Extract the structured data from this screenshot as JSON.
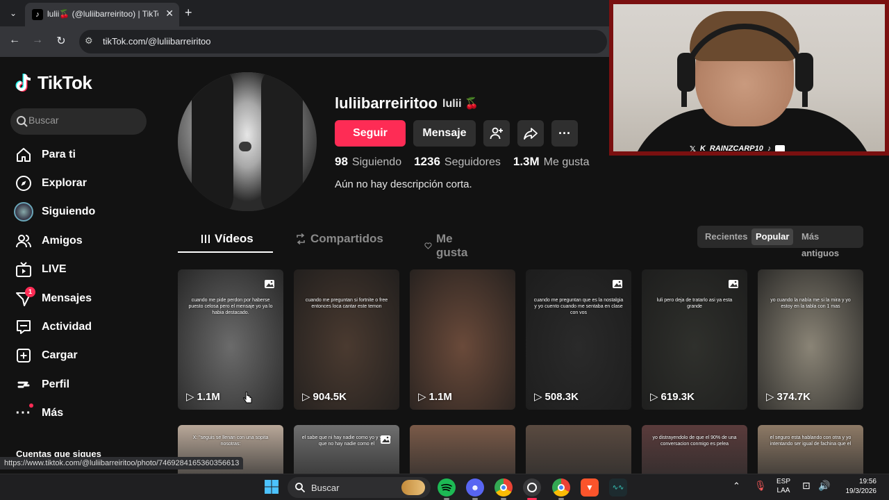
{
  "browser": {
    "tab_title": "lulii🍒 (@luliibarreiritoo) | TikTo",
    "address": "tikTok.com/@luliibarreiritoo",
    "status_link": "https://www.tiktok.com/@luliibarreiritoo/photo/7469284165360356613"
  },
  "sidebar": {
    "logo_text": "TikTok",
    "search_placeholder": "Buscar",
    "items": [
      {
        "label": "Para ti",
        "icon": "home-icon"
      },
      {
        "label": "Explorar",
        "icon": "compass-icon"
      },
      {
        "label": "Siguiendo",
        "icon": "following-avatar-icon"
      },
      {
        "label": "Amigos",
        "icon": "friends-icon"
      },
      {
        "label": "LIVE",
        "icon": "live-icon"
      },
      {
        "label": "Mensajes",
        "icon": "messages-icon",
        "badge": "1"
      },
      {
        "label": "Actividad",
        "icon": "activity-icon"
      },
      {
        "label": "Cargar",
        "icon": "upload-icon"
      },
      {
        "label": "Perfil",
        "icon": "profile-icon"
      },
      {
        "label": "Más",
        "icon": "more-icon"
      }
    ],
    "following_heading": "Cuentas que sigues"
  },
  "profile": {
    "username": "luliibarreiritoo",
    "nickname": "lulii 🍒",
    "follow_label": "Seguir",
    "message_label": "Mensaje",
    "following_count": "98",
    "following_label": "Siguiendo",
    "followers_count": "1236",
    "followers_label": "Seguidores",
    "likes_count": "1.3M",
    "likes_label": "Me gusta",
    "bio": "Aún no hay descripción corta."
  },
  "tabs": [
    {
      "label": "Vídeos",
      "active": true
    },
    {
      "label": "Compartidos",
      "active": false
    },
    {
      "label": "Me gusta",
      "active": false
    }
  ],
  "sort": {
    "options": [
      "Recientes",
      "Popular",
      "Más antiguos"
    ],
    "selected": "Popular"
  },
  "videos_row1": [
    {
      "views": "1.1M",
      "caption": "cuando me pide perdon por haberse puesto celosa pero el mensaje yo ya lo habia destacado.",
      "photo": true,
      "theme": "#6b6b6b"
    },
    {
      "views": "904.5K",
      "caption": "cuando me preguntan si fortnite o free entonces loca cantar este temon",
      "photo": false,
      "theme": "#4a3a30"
    },
    {
      "views": "1.1M",
      "caption": "",
      "photo": false,
      "theme": "#6a4a3a"
    },
    {
      "views": "508.3K",
      "caption": "cuando me preguntan que es la nostalgia y yo cuento cuando me sentaba en clase con vos",
      "photo": true,
      "theme": "#2a2a2a"
    },
    {
      "views": "619.3K",
      "caption": "luli pero deja de tratarlo asi ya esta grande",
      "photo": true,
      "theme": "#2f302c"
    },
    {
      "views": "374.7K",
      "caption": "yo cuando la nabía me si la mira y yo estoy en la tabla con 1 mas",
      "photo": false,
      "theme": "#8a8476"
    }
  ],
  "videos_row2": [
    {
      "caption": "X: \"seguis se llenan con una sopita nosotras:",
      "photo": false,
      "theme": "#b9a899"
    },
    {
      "caption": "el sabe que ni hay nadie como yo y yo se que no hay nadie como el",
      "photo": true,
      "theme": "#6f6f6f"
    },
    {
      "caption": "",
      "photo": false,
      "theme": "#7a5a48"
    },
    {
      "caption": "",
      "photo": false,
      "theme": "#5a4a40"
    },
    {
      "caption": "yo distrayendolo de que el 90% de una conversacion conmigo es pelea",
      "photo": false,
      "theme": "#5a3b3b"
    },
    {
      "caption": "el seguro esta hablando con otra y yo intentando ser igual de fachina que el",
      "photo": false,
      "theme": "#8e7a66"
    }
  ],
  "webcam": {
    "handle": "RAINZCARP10"
  },
  "taskbar": {
    "search_label": "Buscar",
    "lang_top": "ESP",
    "lang_bottom": "LAA",
    "time": "19:56",
    "date": "19/3/2026"
  },
  "colors": {
    "accent": "#fe2c55",
    "background": "#121212"
  }
}
